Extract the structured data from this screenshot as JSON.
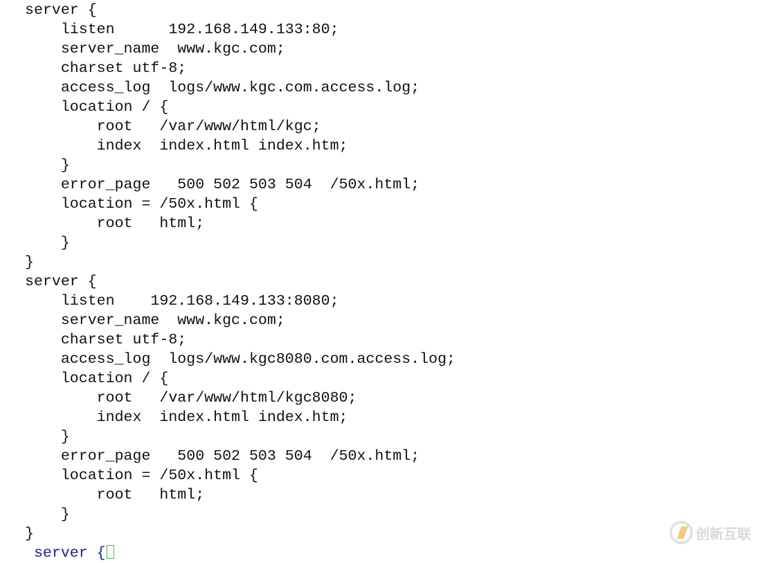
{
  "editor": {
    "lines": [
      "server {",
      "    listen      192.168.149.133:80;",
      "    server_name  www.kgc.com;",
      "    charset utf-8;",
      "    access_log  logs/www.kgc.com.access.log;",
      "    location / {",
      "        root   /var/www/html/kgc;",
      "        index  index.html index.htm;",
      "    }",
      "    error_page   500 502 503 504  /50x.html;",
      "    location = /50x.html {",
      "        root   html;",
      "    }",
      "}",
      "server {",
      "    listen    192.168.149.133:8080;",
      "    server_name  www.kgc.com;",
      "    charset utf-8;",
      "    access_log  logs/www.kgc8080.com.access.log;",
      "    location / {",
      "        root   /var/www/html/kgc8080;",
      "        index  index.html index.htm;",
      "    }",
      "    error_page   500 502 503 504  /50x.html;",
      "    location = /50x.html {",
      "        root   html;",
      "    }",
      "}"
    ],
    "partial_line": " server {",
    "cursor_color": "#3ec03e"
  },
  "watermark": {
    "text": "创新互联",
    "icon": "brand-logo-icon"
  }
}
